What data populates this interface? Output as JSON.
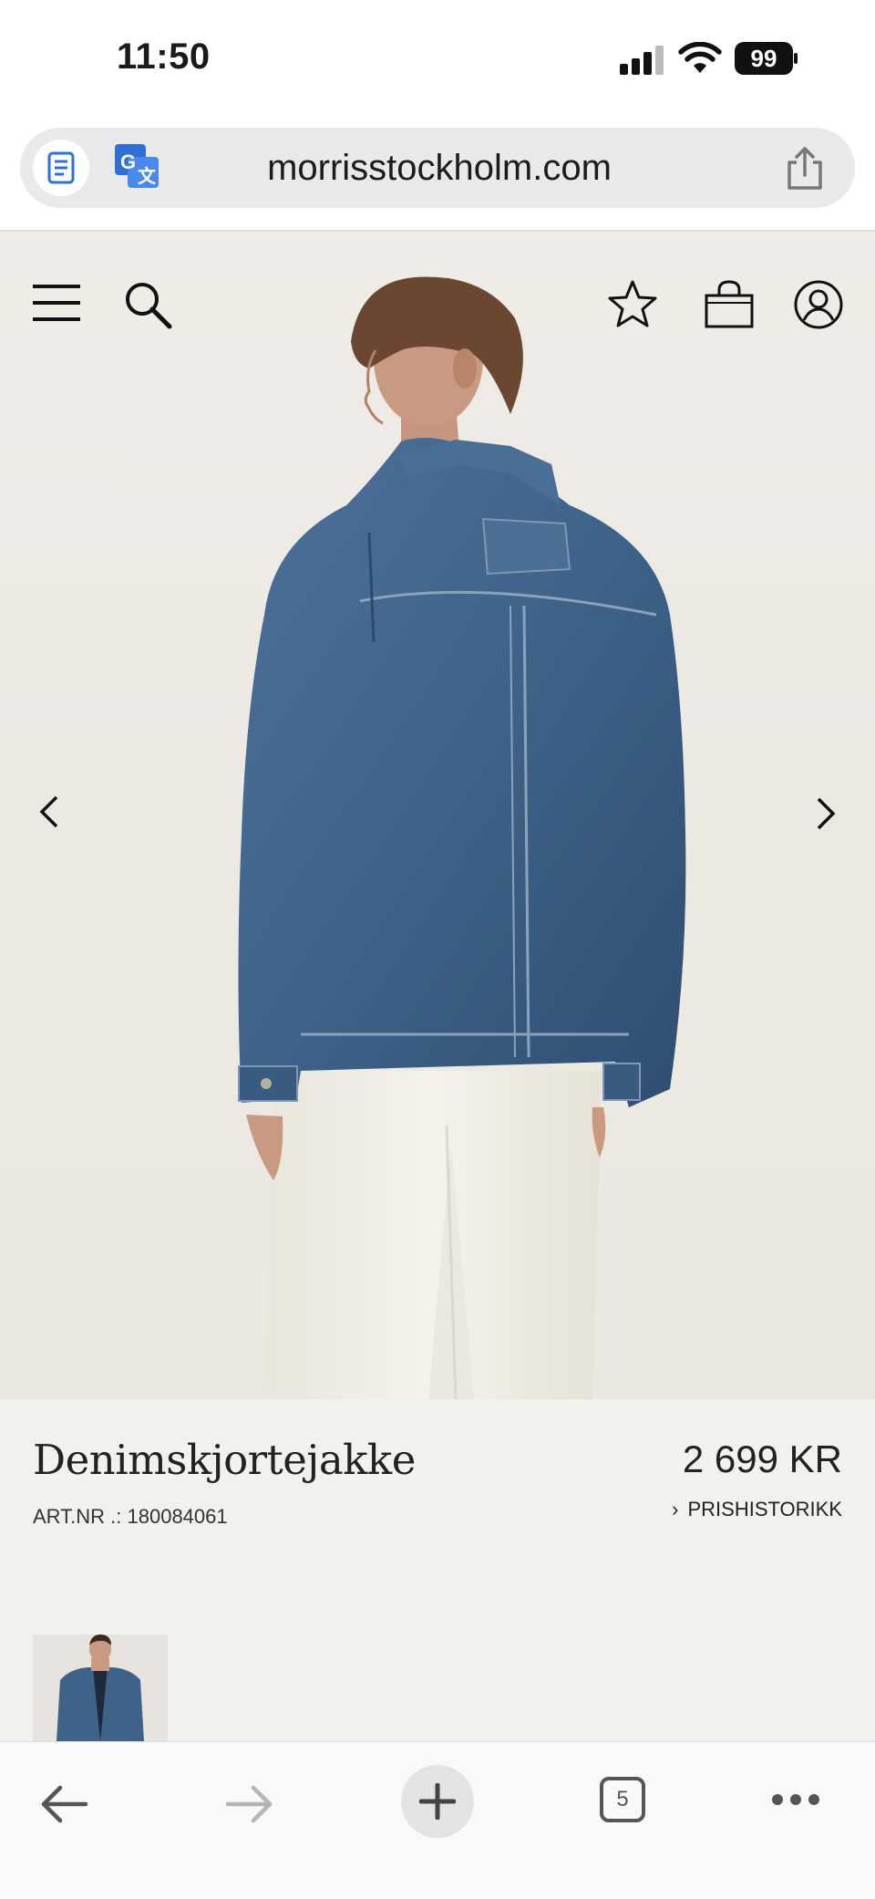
{
  "status_bar": {
    "time": "11:50",
    "battery": "99",
    "icons": [
      "signal-icon",
      "wifi-icon",
      "battery-icon"
    ]
  },
  "browser": {
    "url": "morrisstockholm.com",
    "icons": [
      "reader-icon",
      "translate-icon",
      "share-icon"
    ]
  },
  "site_nav": {
    "icons": [
      "menu-icon",
      "search-icon",
      "favorite-star-icon",
      "shopping-bag-icon",
      "account-icon"
    ]
  },
  "gallery": {
    "prev_icon": "chevron-left-icon",
    "next_icon": "chevron-right-icon",
    "colors": {
      "denim": "#3e6288",
      "pants": "#f1eee4",
      "hair": "#6b4630"
    }
  },
  "product": {
    "title": "Denimskjortejakke",
    "art_nr": "ART.NR .: 180084061",
    "price": "2 699 KR",
    "price_history": "PRISHISTORIKK"
  },
  "toolbar": {
    "tabs_count": "5",
    "icons": [
      "back-arrow-icon",
      "forward-arrow-icon",
      "plus-icon",
      "tabs-icon",
      "more-icon"
    ]
  }
}
